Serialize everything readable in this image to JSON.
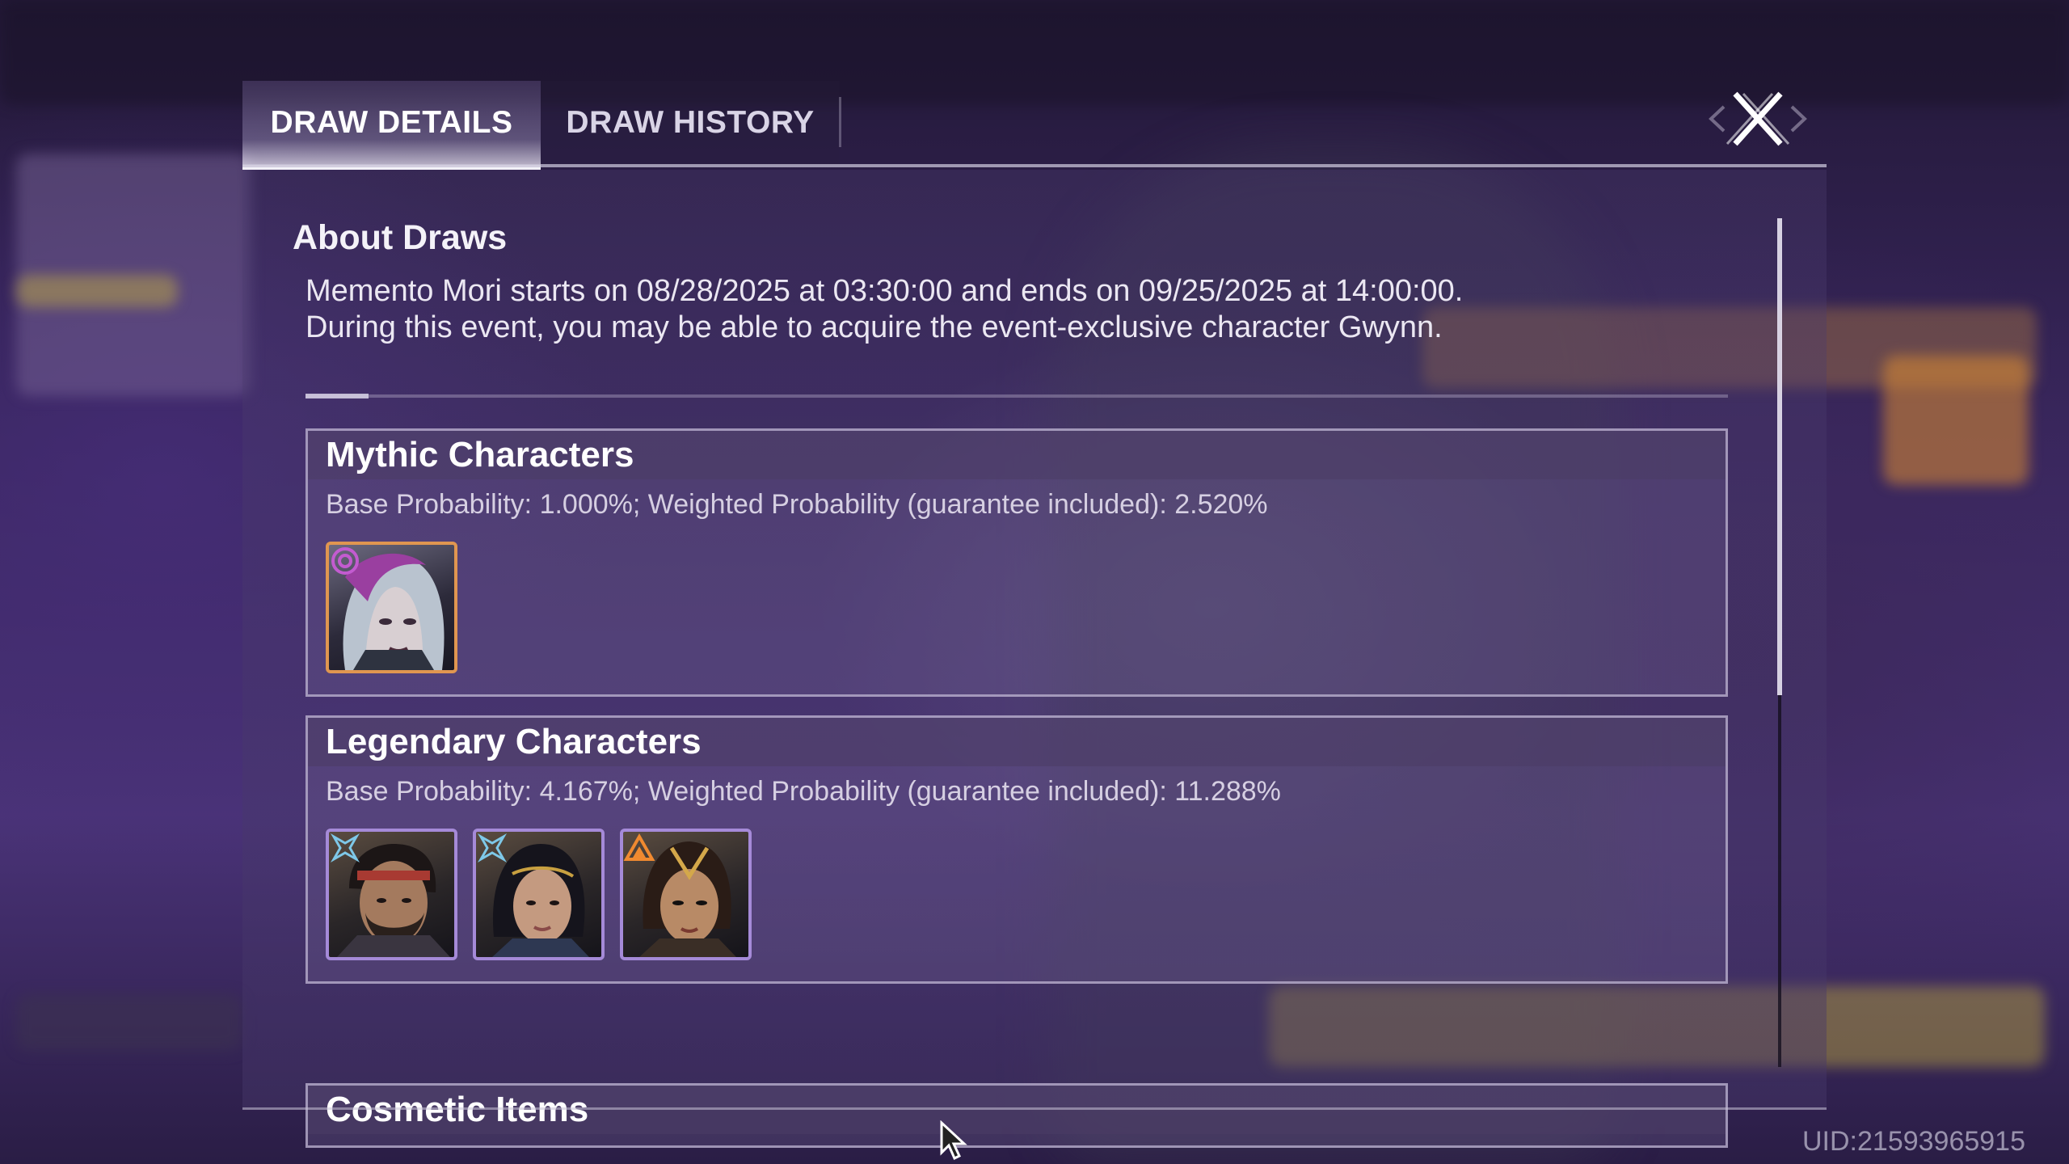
{
  "tabs": {
    "draw_details": "DRAW DETAILS",
    "draw_history": "DRAW HISTORY"
  },
  "about": {
    "title": "About Draws",
    "line1": "Memento Mori starts on 08/28/2025 at 03:30:00 and ends on 09/25/2025 at 14:00:00.",
    "line2": "During this event, you may be able to acquire the event-exclusive character Gwynn."
  },
  "sections": [
    {
      "title": "Mythic Characters",
      "probability": "Base Probability: 1.000%; Weighted Probability (guarantee included): 2.520%",
      "portraits": [
        {
          "name": "white-haired-woman",
          "badge": "spiral-icon",
          "frame_color": "#e09650"
        }
      ]
    },
    {
      "title": "Legendary Characters",
      "probability": "Base Probability: 4.167%; Weighted Probability (guarantee included): 11.288%",
      "portraits": [
        {
          "name": "bearded-man-headband",
          "badge": "cross-star-icon",
          "frame_color": "#a58ad8"
        },
        {
          "name": "dark-haired-woman",
          "badge": "cross-star-icon",
          "frame_color": "#a58ad8"
        },
        {
          "name": "woman-gold-headpiece",
          "badge": "triangle-icon",
          "frame_color": "#a58ad8"
        }
      ]
    },
    {
      "title": "Cosmetic Items"
    }
  ],
  "uid": "UID:21593965915"
}
